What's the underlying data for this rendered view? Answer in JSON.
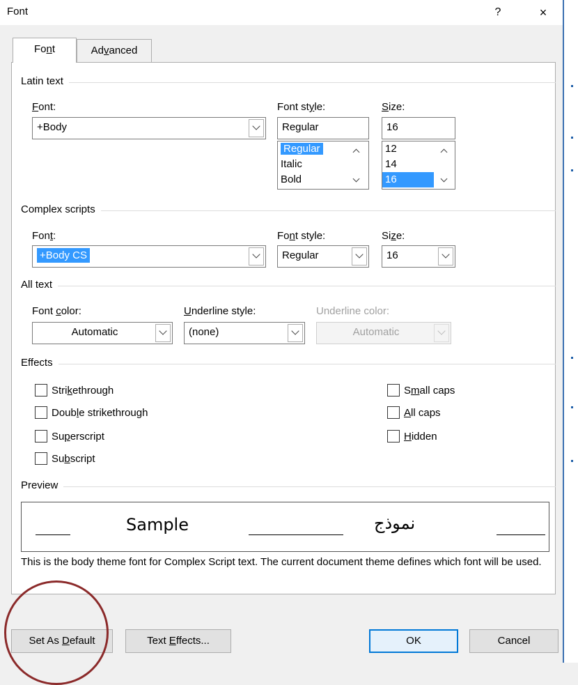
{
  "window": {
    "title": "Font",
    "help": "?",
    "close": "×"
  },
  "tabs": [
    {
      "label_pre": "Fo",
      "label_u": "n",
      "label_post": "t",
      "active": true
    },
    {
      "label_pre": "Ad",
      "label_u": "v",
      "label_post": "anced",
      "active": false
    }
  ],
  "latin": {
    "heading": "Latin text",
    "font_label_u": "F",
    "font_label_rest": "ont:",
    "style_label_pre": "Font st",
    "style_label_u": "y",
    "style_label_post": "le:",
    "size_label_u": "S",
    "size_label_rest": "ize:",
    "font_value": "+Body",
    "style_value": "Regular",
    "size_value": "16",
    "style_list": [
      "Regular",
      "Italic",
      "Bold"
    ],
    "style_selected": "Regular",
    "size_list": [
      "12",
      "14",
      "16"
    ],
    "size_selected": "16"
  },
  "complex": {
    "heading": "Complex scripts",
    "font_label_pre": "Fon",
    "font_label_u": "t",
    "font_label_post": ":",
    "style_label_pre": "Fo",
    "style_label_u": "n",
    "style_label_post": "t style:",
    "size_label_pre": "Si",
    "size_label_u": "z",
    "size_label_post": "e:",
    "font_value": "+Body CS",
    "style_value": "Regular",
    "size_value": "16"
  },
  "all_text": {
    "heading": "All text",
    "color_label_pre": "Font ",
    "color_label_u": "c",
    "color_label_post": "olor:",
    "underline_label_pre": "",
    "underline_label_u": "U",
    "underline_label_post": "nderline style:",
    "underline_color_label": "Underline color:",
    "color_value": "Automatic",
    "underline_value": "(none)",
    "underline_color_value": "Automatic"
  },
  "effects": {
    "heading": "Effects",
    "left": [
      {
        "pre": "Stri",
        "u": "k",
        "post": "ethrough"
      },
      {
        "pre": "Doub",
        "u": "l",
        "post": "e strikethrough"
      },
      {
        "pre": "Su",
        "u": "p",
        "post": "erscript"
      },
      {
        "pre": "Su",
        "u": "b",
        "post": "script"
      }
    ],
    "right": [
      {
        "pre": "S",
        "u": "m",
        "post": "all caps"
      },
      {
        "pre": "",
        "u": "A",
        "post": "ll caps"
      },
      {
        "pre": "",
        "u": "H",
        "post": "idden"
      }
    ]
  },
  "preview": {
    "heading": "Preview",
    "sample": "Sample",
    "arabic": "نموذج",
    "description": "This is the body theme font for Complex Script text. The current document theme defines which font will be used."
  },
  "buttons": {
    "set_default_pre": "Set As ",
    "set_default_u": "D",
    "set_default_post": "efault",
    "text_effects_pre": "Text ",
    "text_effects_u": "E",
    "text_effects_post": "ffects...",
    "ok": "OK",
    "cancel": "Cancel"
  },
  "colors": {
    "selection": "#3399ff",
    "default_button_border": "#0078d7",
    "annotation_circle": "#8b2a2a"
  }
}
